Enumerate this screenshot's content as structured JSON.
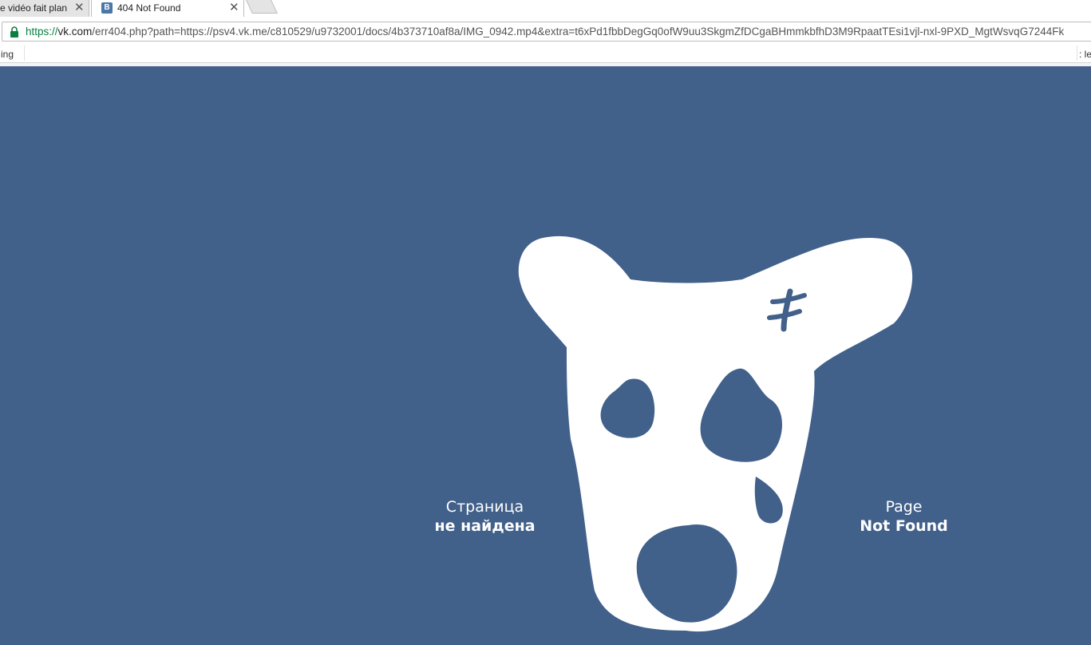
{
  "browser": {
    "tabs": [
      {
        "title": "e vidéo fait plan",
        "active": false
      },
      {
        "title": "404 Not Found",
        "active": true,
        "favicon": "B"
      }
    ],
    "url": {
      "scheme": "https://",
      "host": "vk.com",
      "path": "/err404.php?path=https://psv4.vk.me/c810529/u9732001/docs/4b373710af8a/IMG_0942.mp4&extra=t6xPd1fbbDegGq0ofW9uu3SkgmZfDCgaBHmmkbfhD3M9RpaatTEsi1vjl-nxl-9PXD_MgtWsvqG7244Fk"
    },
    "bookmarks": {
      "left": "ing",
      "right": ": le"
    }
  },
  "error_page": {
    "ru_line1": "Страница",
    "ru_line2": "не найдена",
    "en_line1": "Page",
    "en_line2": "Not Found"
  },
  "colors": {
    "background": "#41608a",
    "dog": "#ffffff",
    "secure": "#0b8043"
  }
}
